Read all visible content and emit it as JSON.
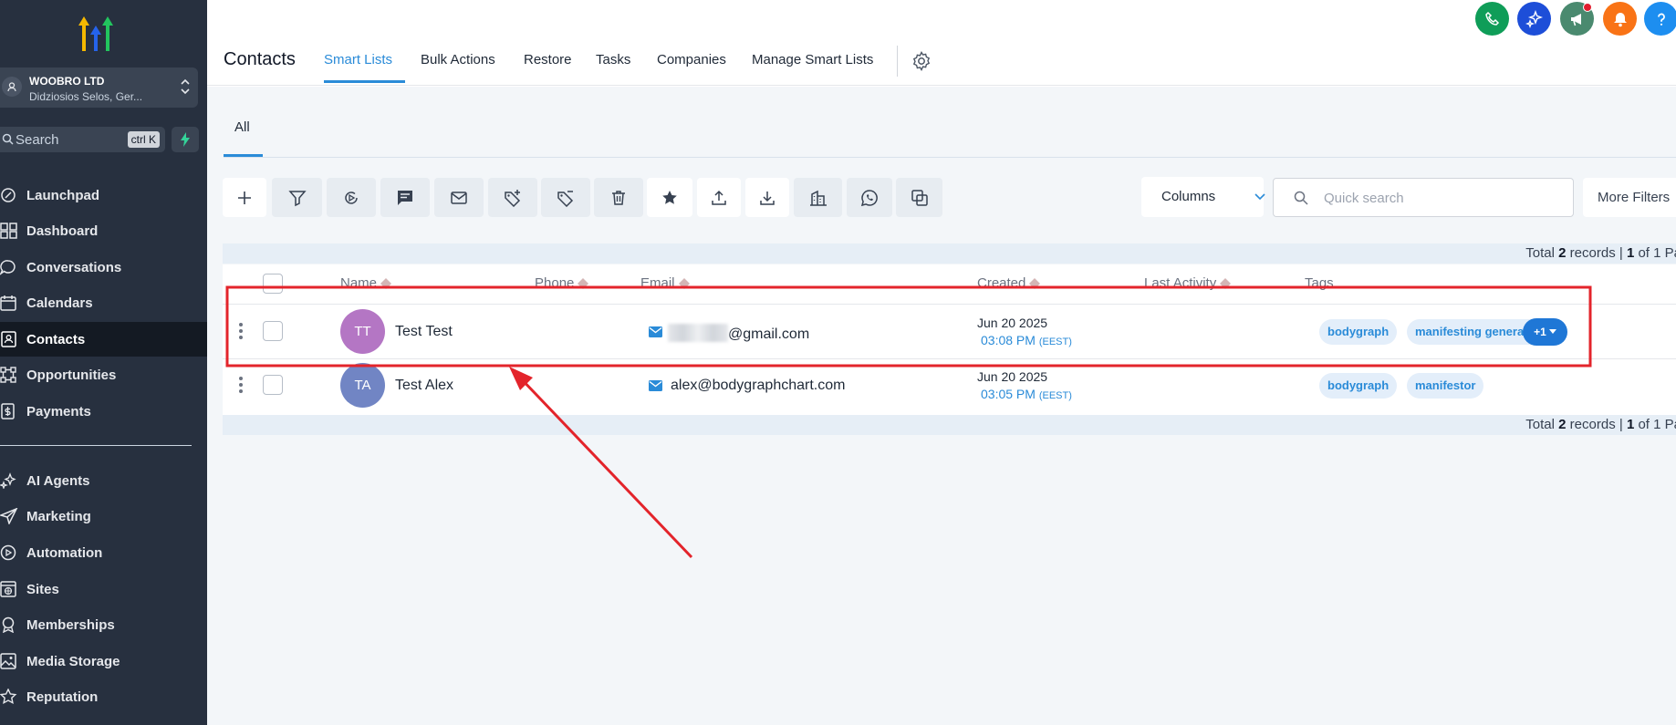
{
  "sidebar": {
    "account": {
      "name": "WOOBRO LTD",
      "address": "Didziosios Selos, Ger..."
    },
    "search": {
      "placeholder": "Search",
      "shortcut": "ctrl K"
    },
    "items": [
      {
        "label": "Launchpad",
        "icon": "rocket-icon"
      },
      {
        "label": "Dashboard",
        "icon": "grid-icon"
      },
      {
        "label": "Conversations",
        "icon": "chat-icon"
      },
      {
        "label": "Calendars",
        "icon": "calendar-icon"
      },
      {
        "label": "Contacts",
        "icon": "contacts-icon",
        "active": true
      },
      {
        "label": "Opportunities",
        "icon": "funnel-icon"
      },
      {
        "label": "Payments",
        "icon": "payments-icon"
      },
      {
        "label": "AI Agents",
        "icon": "sparkle-icon"
      },
      {
        "label": "Marketing",
        "icon": "send-icon"
      },
      {
        "label": "Automation",
        "icon": "automation-icon"
      },
      {
        "label": "Sites",
        "icon": "globe-icon"
      },
      {
        "label": "Memberships",
        "icon": "badge-icon"
      },
      {
        "label": "Media Storage",
        "icon": "image-icon"
      },
      {
        "label": "Reputation",
        "icon": "star-icon"
      }
    ]
  },
  "header": {
    "title": "Contacts",
    "tabs": [
      "Smart Lists",
      "Bulk Actions",
      "Restore",
      "Tasks",
      "Companies",
      "Manage Smart Lists"
    ],
    "active_tab": "Smart Lists",
    "icons": [
      {
        "icon": "phone-icon",
        "color": "#0f9d58"
      },
      {
        "icon": "ai-sparkle-icon",
        "color": "#1d4ed8"
      },
      {
        "icon": "megaphone-icon",
        "color": "#4a8a6f"
      },
      {
        "icon": "bell-icon",
        "color": "#f97316"
      },
      {
        "icon": "help-icon",
        "color": "#1d8ef0"
      }
    ]
  },
  "subtabs": {
    "all": "All"
  },
  "toolbar": {
    "columns_label": "Columns",
    "search_placeholder": "Quick search",
    "more_filters": "More Filters"
  },
  "summary": {
    "prefix": "Total",
    "count": "2",
    "mid": "records |",
    "page": "1",
    "suffix": "of 1 Pa"
  },
  "table": {
    "columns": [
      "Name",
      "Phone",
      "Email",
      "Created",
      "Last Activity",
      "Tags"
    ],
    "rows": [
      {
        "initials": "TT",
        "name": "Test Test",
        "avatar_color": "#b476c4",
        "email": "@gmail.com",
        "created_date": "Jun 20 2025",
        "created_time": "03:08 PM",
        "tz": "(EEST)",
        "tags": [
          "bodygraph",
          "manifesting generator"
        ],
        "more": "+1"
      },
      {
        "initials": "TA",
        "name": "Test Alex",
        "avatar_color": "#7185c4",
        "email": "alex@bodygraphchart.com",
        "created_date": "Jun 20 2025",
        "created_time": "03:05 PM",
        "tz": "(EEST)",
        "tags": [
          "bodygraph",
          "manifestor"
        ]
      }
    ]
  },
  "annotation": {
    "color": "#e3242b"
  }
}
